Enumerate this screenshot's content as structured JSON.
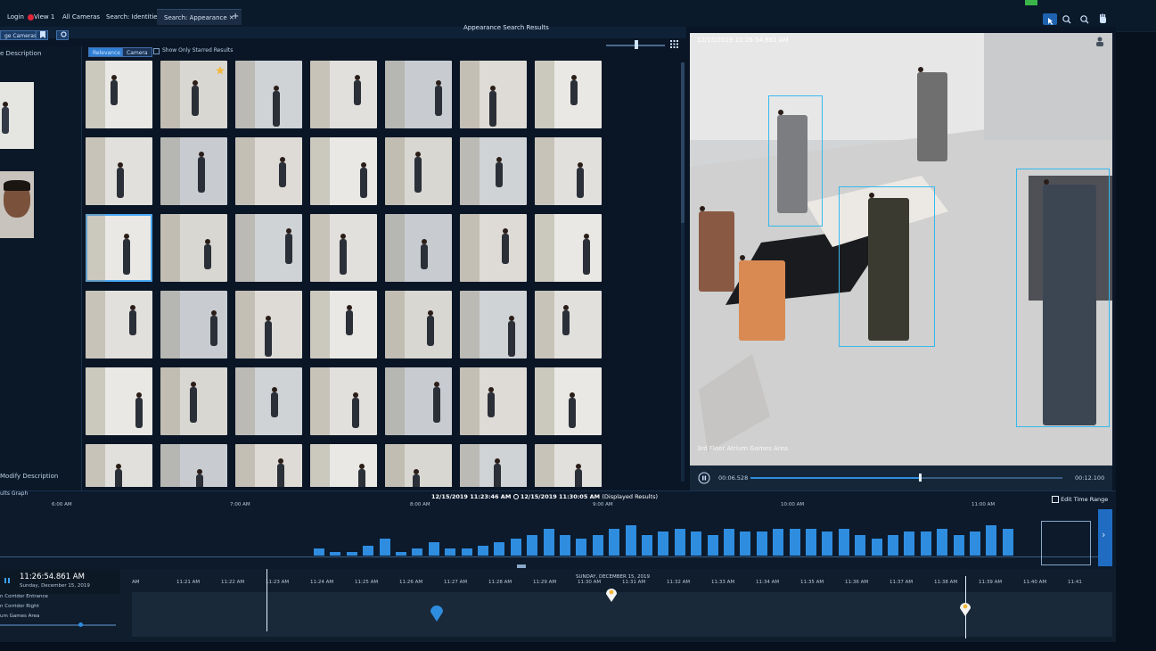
{
  "tabs": [
    {
      "label": "Login"
    },
    {
      "label": "View 1"
    },
    {
      "label": "All Cameras"
    },
    {
      "label": "Search: Identities"
    },
    {
      "label": "Search: Appearance"
    }
  ],
  "tab_close": "✕",
  "tab_add": "+",
  "panel_title": "Appearance Search Results",
  "left_panel": {
    "change_cameras": "ge Cameras",
    "description_heading": "e Description",
    "modify_description": "Modify Description",
    "results_graph": "ults Graph"
  },
  "filters": {
    "relevance": "Relevance",
    "camera": "Camera",
    "starred": "Show Only Starred Results"
  },
  "viewer": {
    "timestamp": "12/15/2019 11:26:54.861 AM",
    "camera_name": "3rd Floor Atrium Games Area",
    "elapsed": "00:06.528",
    "total": "00:12.100"
  },
  "range": {
    "start": "12/15/2019 11:23:46 AM",
    "end": "12/15/2019 11:30:05 AM",
    "note": "(Displayed Results)",
    "edit_label": "Edit Time Range"
  },
  "histogram_ticks": [
    "6:00 AM",
    "7:00 AM",
    "8:00 AM",
    "9:00 AM",
    "10:00 AM",
    "11:00 AM"
  ],
  "histogram_values": [
    2,
    1,
    1,
    3,
    5,
    1,
    2,
    4,
    2,
    2,
    3,
    4,
    5,
    6,
    8,
    6,
    5,
    6,
    8,
    9,
    6,
    7,
    8,
    7,
    6,
    8,
    7,
    7,
    8,
    8,
    8,
    7,
    8,
    6,
    5,
    6,
    7,
    7,
    8,
    6,
    7,
    9,
    8
  ],
  "timeline": {
    "time": "11:26:54.861 AM",
    "date": "Sunday, December 15, 2019",
    "day_label": "SUNDAY, DECEMBER 15, 2019",
    "tracks": [
      "n Corridor Entrance",
      "n Corridor Right",
      "um Games Area"
    ],
    "ticks": [
      "AM",
      "11:21 AM",
      "11:22 AM",
      "11:23 AM",
      "11:24 AM",
      "11:25 AM",
      "11:26 AM",
      "11:27 AM",
      "11:28 AM",
      "11:29 AM",
      "11:30 AM",
      "11:31 AM",
      "11:32 AM",
      "11:33 AM",
      "11:34 AM",
      "11:35 AM",
      "11:36 AM",
      "11:37 AM",
      "11:38 AM",
      "11:39 AM",
      "11:40 AM",
      "11:41"
    ]
  },
  "colors": {
    "accent": "#2f8de0",
    "bbox": "#34b9ef",
    "star": "#f4b73a"
  }
}
